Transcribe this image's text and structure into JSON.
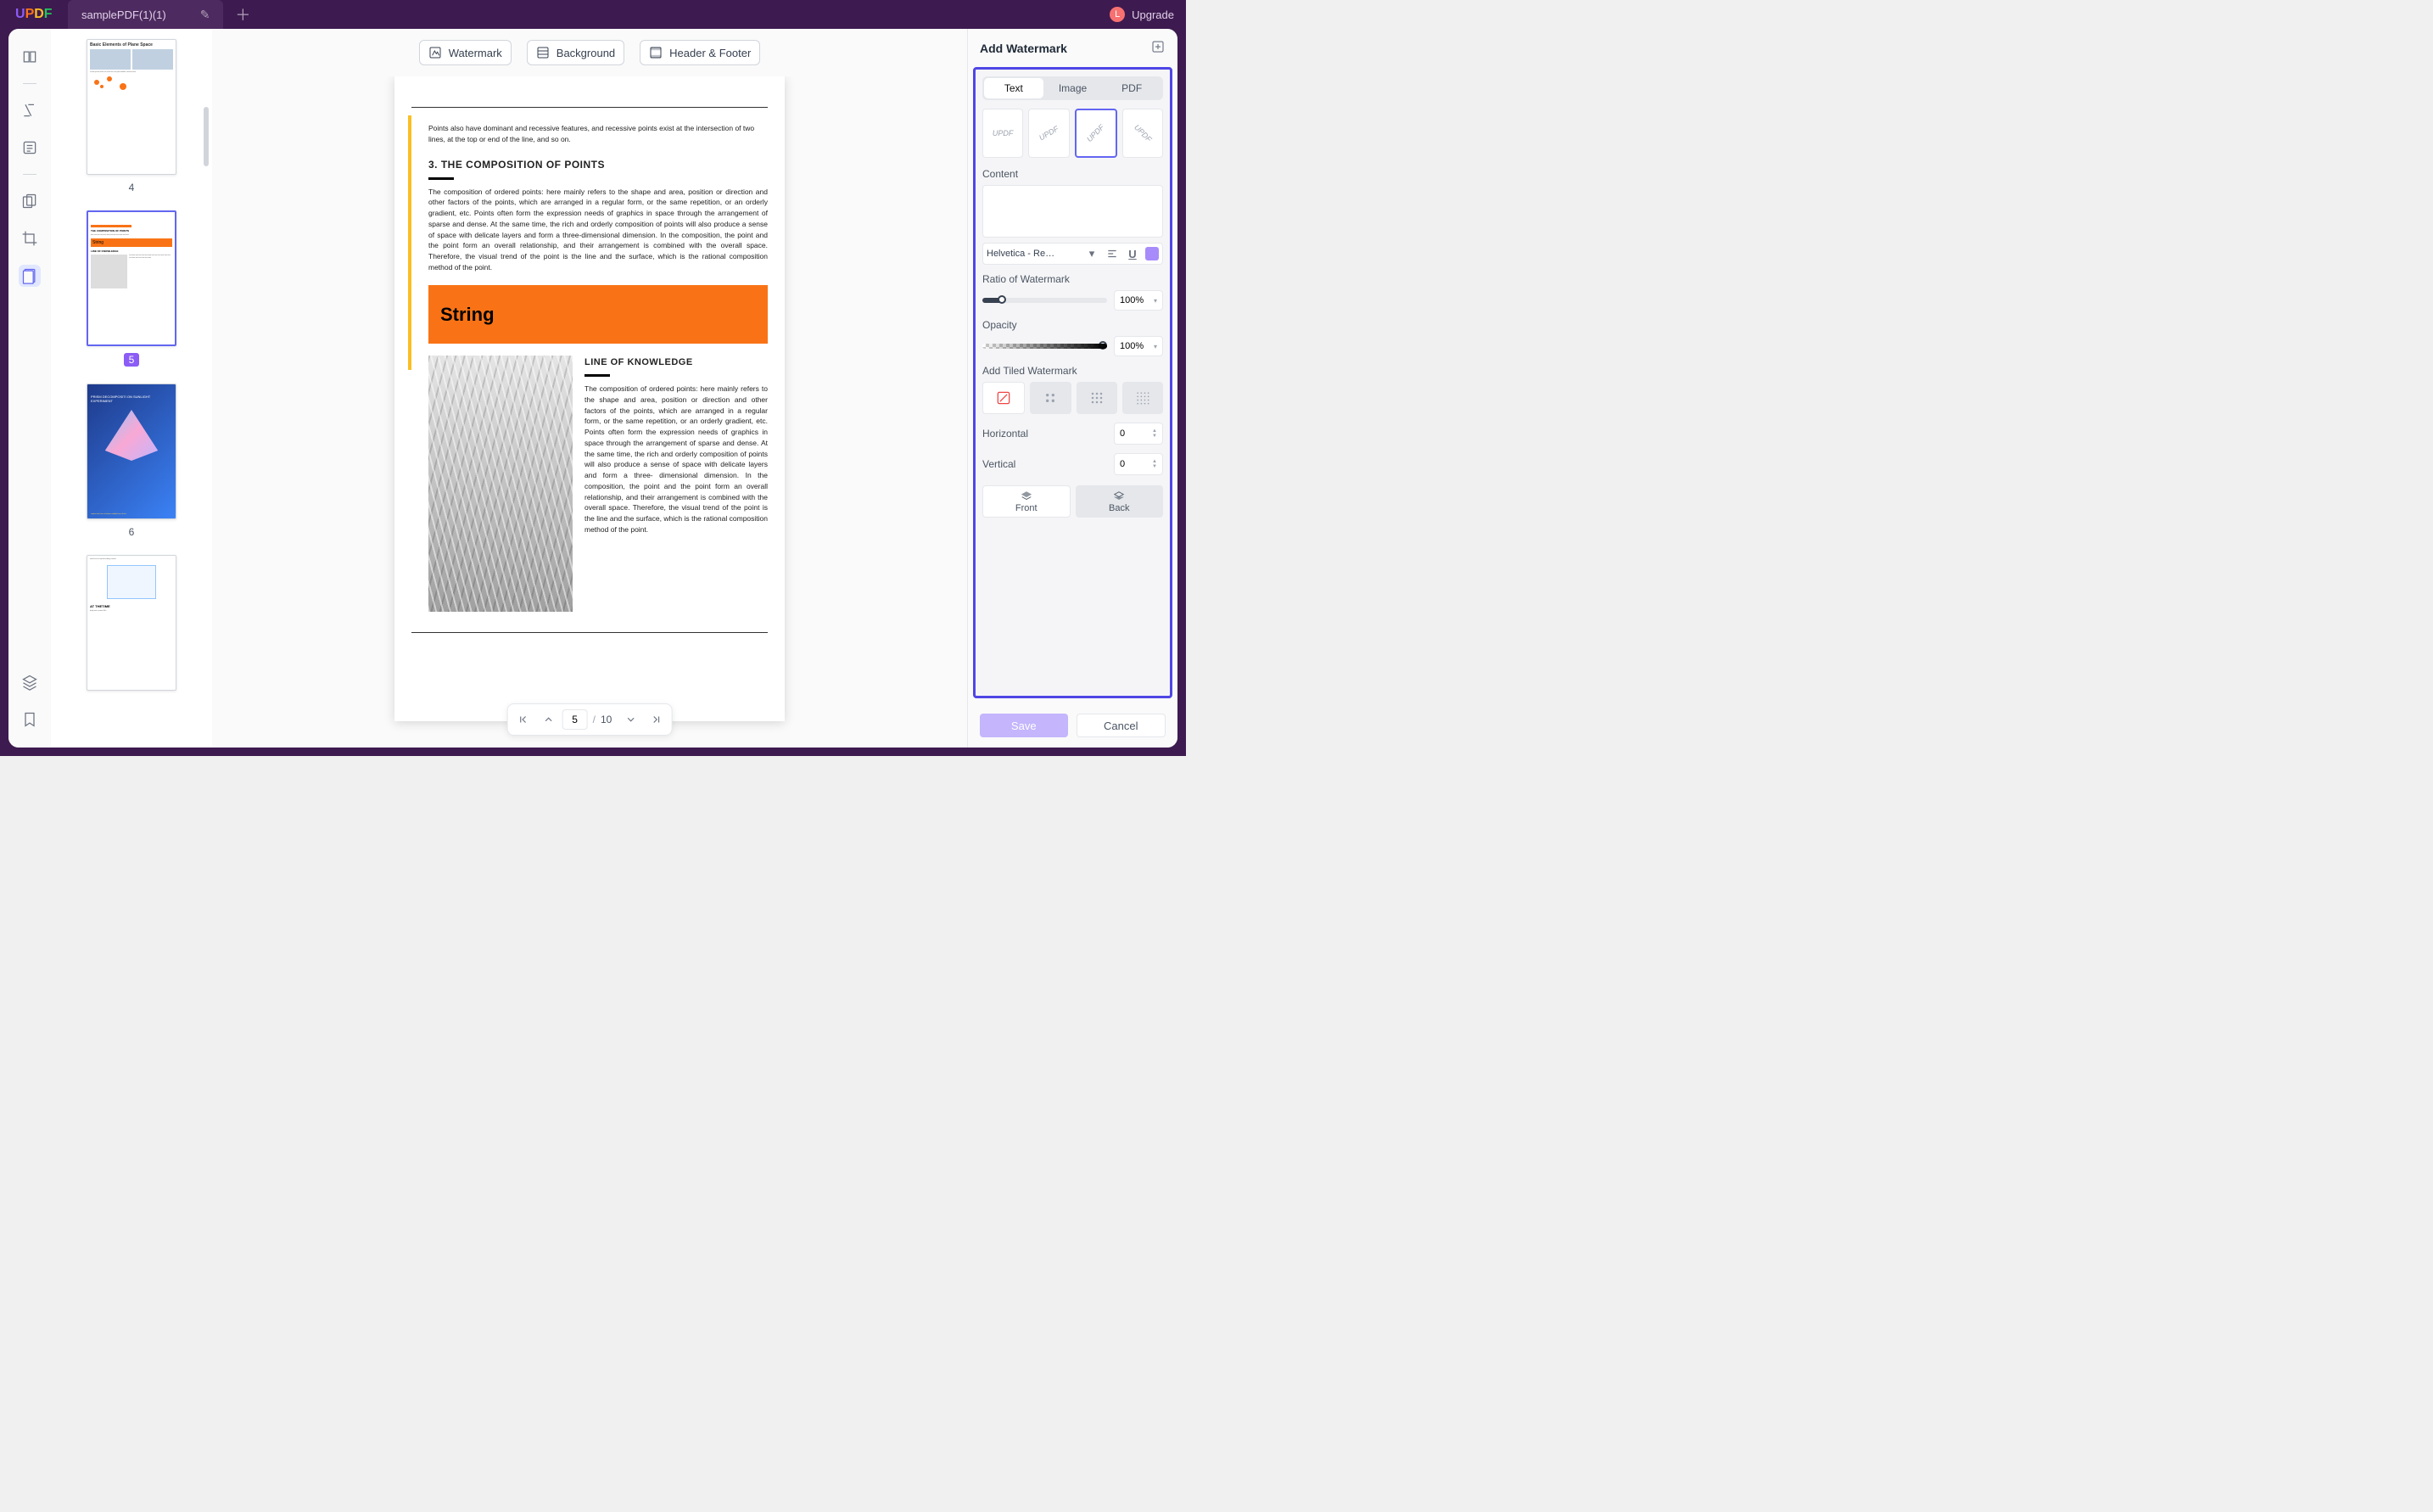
{
  "titlebar": {
    "filename": "samplePDF(1)(1)",
    "upgrade": "Upgrade",
    "avatar_initial": "L"
  },
  "top_tools": {
    "watermark": "Watermark",
    "background": "Background",
    "header_footer": "Header & Footer"
  },
  "thumbs": {
    "p4": "4",
    "p5": "5",
    "p6": "6",
    "t4_title": "Basic Elements of Plane Space",
    "t5_string": "String",
    "t6_title": "PRISM DECOMPOSITI ON SUNLIGHT EXPERIMENT",
    "t7_title": "AT THETIME"
  },
  "page": {
    "intro": "Points also have dominant and recessive features, and recessive points exist at the intersection of two lines, at the top or end of the line, and so on.",
    "h1": "3. THE COMPOSITION OF POINTS",
    "body1": "The composition of ordered points: here mainly refers to the shape and area, position or direction and other factors of the points, which are arranged in a regular form, or the same repetition, or an orderly gradient, etc. Points often form the expression needs of graphics in space through the arrangement of sparse and dense. At the same time, the rich and orderly composition of points will also produce a sense of space with delicate layers and form a three-dimensional dimension. In the composition, the point and the point form an overall relationship, and their arrangement is combined with the overall space. Therefore, the visual trend of the point is the line and the surface, which is the rational composition method of the point.",
    "string": "String",
    "h2": "LINE OF KNOWLEDGE",
    "body2": "The composition of ordered points: here mainly refers to the shape and area, position or direction and other factors of the points, which are arranged in a regular form, or the same repetition, or an orderly gradient, etc. Points often form the expression needs of graphics in space through the arrangement of sparse and dense. At the same time, the rich and orderly composition of points will also produce a sense of space with delicate layers and form a three- dimensional dimension. In the composition, the point and the point form an overall relationship, and their arrangement is combined with the overall space. Therefore, the visual trend of the point is the line and the surface, which is the rational composition method of the point."
  },
  "nav": {
    "current": "5",
    "sep": "/",
    "total": "10"
  },
  "panel": {
    "title": "Add Watermark",
    "tabs": {
      "text": "Text",
      "image": "Image",
      "pdf": "PDF"
    },
    "orient_label": "UPDF",
    "content_label": "Content",
    "font": "Helvetica - Re…",
    "ratio_label": "Ratio of Watermark",
    "ratio_val": "100%",
    "opacity_label": "Opacity",
    "opacity_val": "100%",
    "tile_label": "Add Tiled Watermark",
    "horizontal": "Horizontal",
    "vertical": "Vertical",
    "h_val": "0",
    "v_val": "0",
    "front": "Front",
    "back": "Back",
    "save": "Save",
    "cancel": "Cancel"
  }
}
